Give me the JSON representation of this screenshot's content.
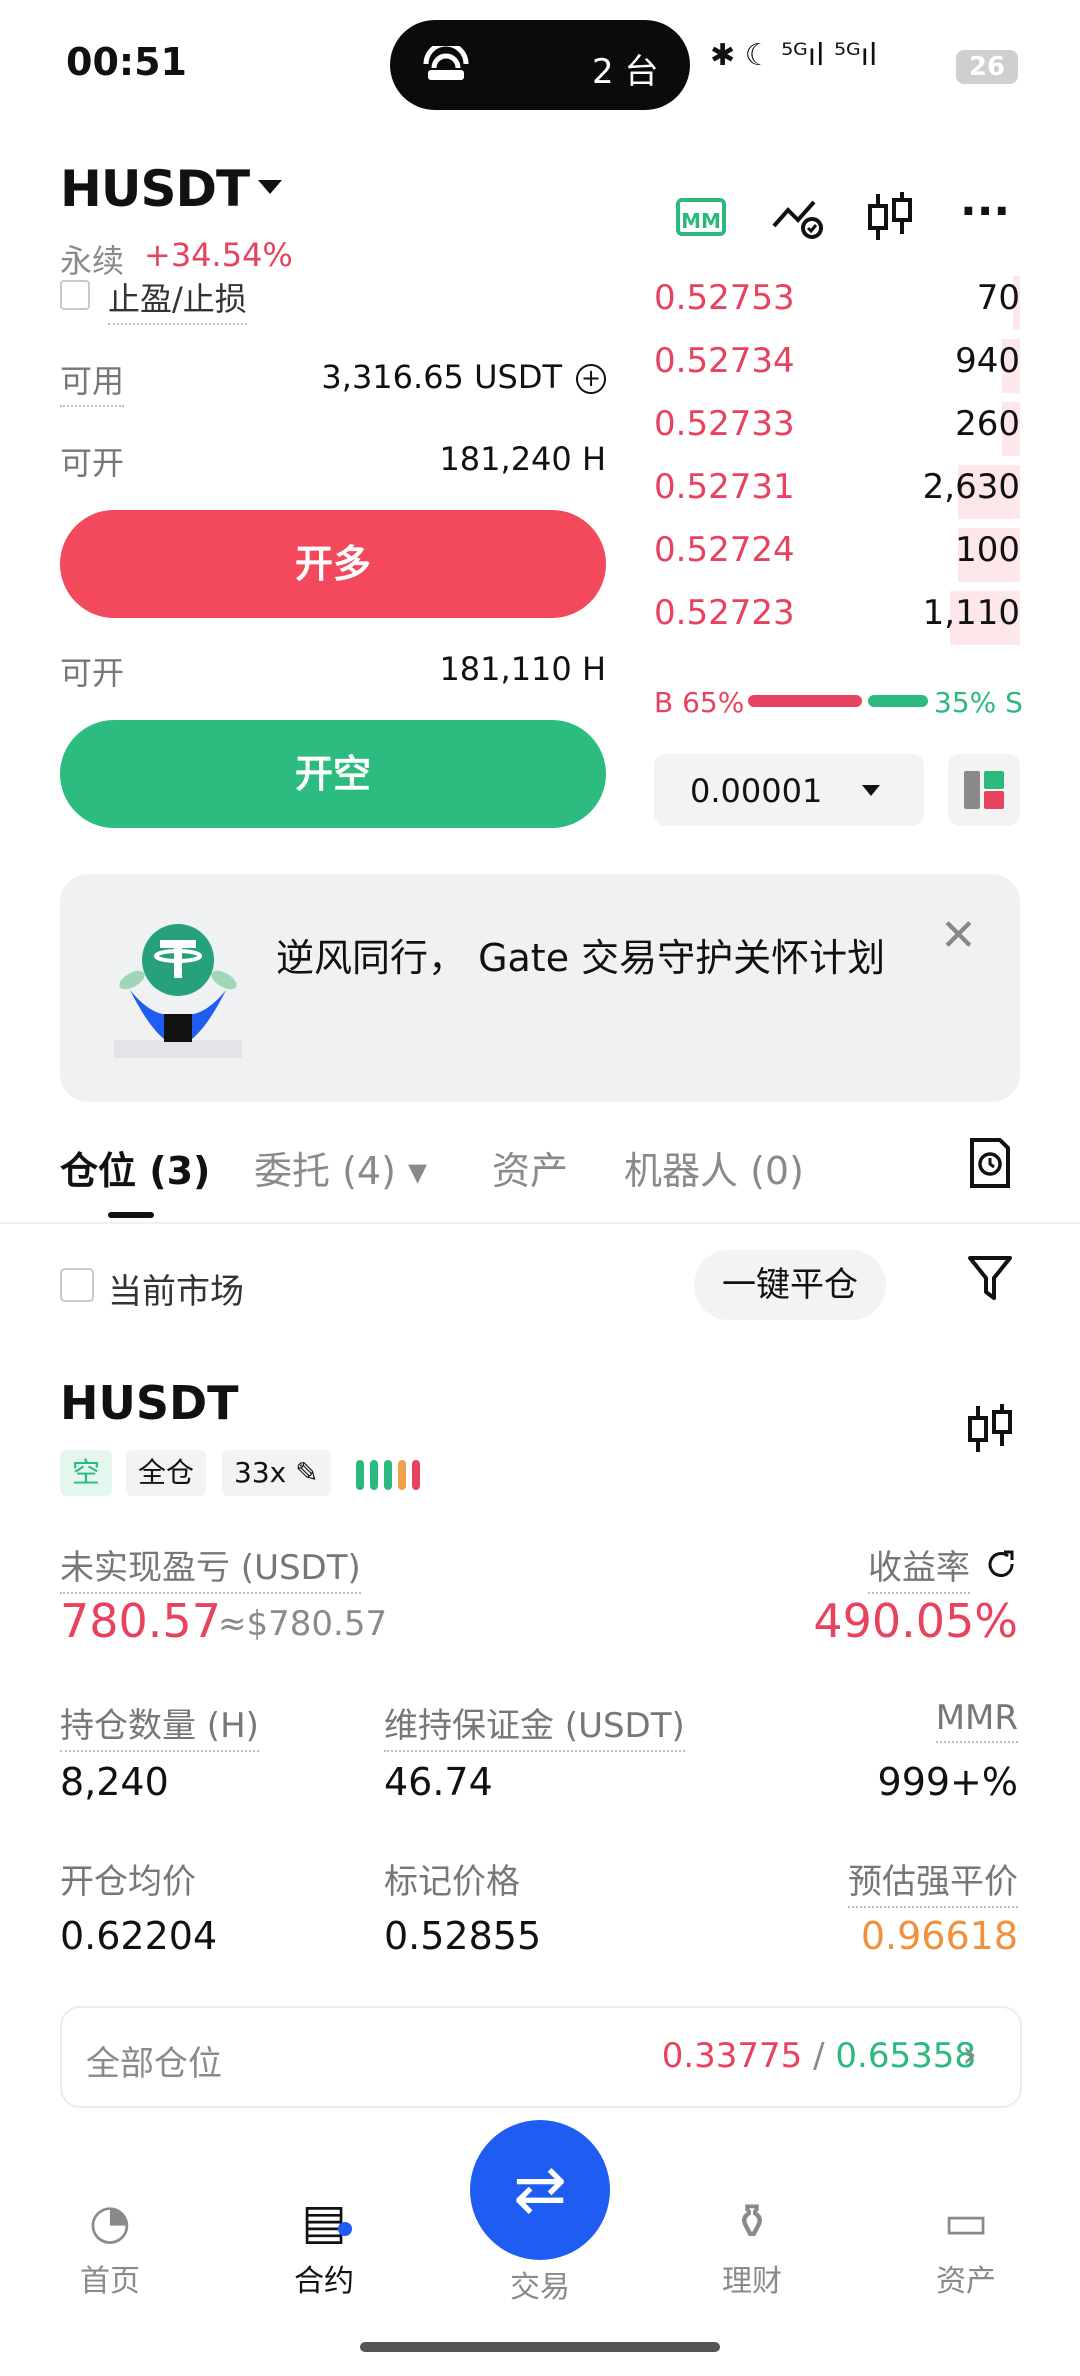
{
  "status_bar": {
    "time": "00:51",
    "island_count": "2 台",
    "icons": "✱ ☾ ⁵ᴳıl ⁵ᴳıl",
    "battery": "26"
  },
  "header": {
    "symbol": "HUSDT",
    "type": "永续",
    "change": "+34.54%",
    "mm_label": "MM",
    "more": "···"
  },
  "form": {
    "tp_sl_label": "止盈/止损",
    "available_label": "可用",
    "available_value": "3,316.65 USDT",
    "open_long_label": "可开",
    "open_long_value": "181,240 H",
    "long_button": "开多",
    "open_short_label": "可开",
    "open_short_value": "181,110 H",
    "short_button": "开空"
  },
  "orderbook": {
    "asks": [
      {
        "price": "0.52753",
        "qty": "70",
        "depth": 0.02
      },
      {
        "price": "0.52734",
        "qty": "940",
        "depth": 0.05
      },
      {
        "price": "0.52733",
        "qty": "260",
        "depth": 0.05
      },
      {
        "price": "0.52731",
        "qty": "2,630",
        "depth": 0.17
      },
      {
        "price": "0.52724",
        "qty": "100",
        "depth": 0.17
      },
      {
        "price": "0.52723",
        "qty": "1,110",
        "depth": 0.19
      }
    ],
    "buy_ratio": "B 65%",
    "sell_ratio": "35% S",
    "tick_size": "0.00001"
  },
  "banner": {
    "text": "逆风同行， Gate 交易守护关怀计划",
    "close": "✕"
  },
  "tabs": [
    {
      "label": "仓位 (3)"
    },
    {
      "label": "委托 (4) ▾"
    },
    {
      "label": "资产"
    },
    {
      "label": "机器人 (0)"
    }
  ],
  "filters": {
    "current_market": "当前市场",
    "close_all": "一键平仓"
  },
  "position": {
    "symbol": "HUSDT",
    "side_tag": "空",
    "margin_tag": "全仓",
    "leverage_tag": "33x ✎",
    "pnl_label": "未实现盈亏 (USDT)",
    "pnl_value": "780.57",
    "pnl_usd": "≈$780.57",
    "roe_label": "收益率",
    "roe_value": "490.05%",
    "size_label": "持仓数量 (H)",
    "size_value": "8,240",
    "mm_label": "维持保证金 (USDT)",
    "mm_value": "46.74",
    "mmr_label": "MMR",
    "mmr_value": "999+%",
    "entry_label": "开仓均价",
    "entry_value": "0.62204",
    "mark_label": "标记价格",
    "mark_value": "0.52855",
    "liq_label": "预估强平价",
    "liq_value": "0.96618",
    "adl_colors": [
      "#2cb97e",
      "#2cb97e",
      "#2cb97e",
      "#f0a04b",
      "#e8435e"
    ]
  },
  "all_positions": {
    "label": "全部仓位",
    "value_red": "0.33775",
    "sep": " / ",
    "value_green": "0.65358",
    "chevron": "›"
  },
  "bottom_nav": [
    {
      "label": "首页",
      "icon": "◔"
    },
    {
      "label": "合约",
      "icon": "▤"
    },
    {
      "label": "交易",
      "icon": "⇄"
    },
    {
      "label": "理财",
      "icon": "⚱"
    },
    {
      "label": "资产",
      "icon": "▭"
    }
  ]
}
